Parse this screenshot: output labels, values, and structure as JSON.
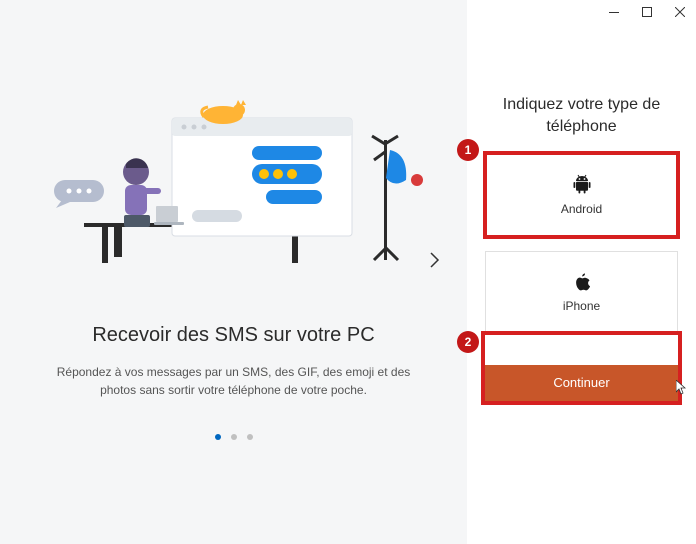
{
  "left": {
    "title": "Recevoir des SMS sur votre PC",
    "subtitle": "Répondez à vos messages par un SMS, des GIF, des emoji et des photos sans sortir votre téléphone de votre poche.",
    "dot_count": 3,
    "active_dot": 0
  },
  "right": {
    "title": "Indiquez votre type de téléphone",
    "options": [
      {
        "label": "Android",
        "icon": "android"
      },
      {
        "label": "iPhone",
        "icon": "apple"
      }
    ],
    "continue_label": "Continuer"
  },
  "annotations": {
    "badge1": "1",
    "badge2": "2"
  },
  "colors": {
    "accent": "#0067c0",
    "continue_bg": "#c85629",
    "highlight": "#d62020",
    "badge_bg": "#c31818"
  }
}
